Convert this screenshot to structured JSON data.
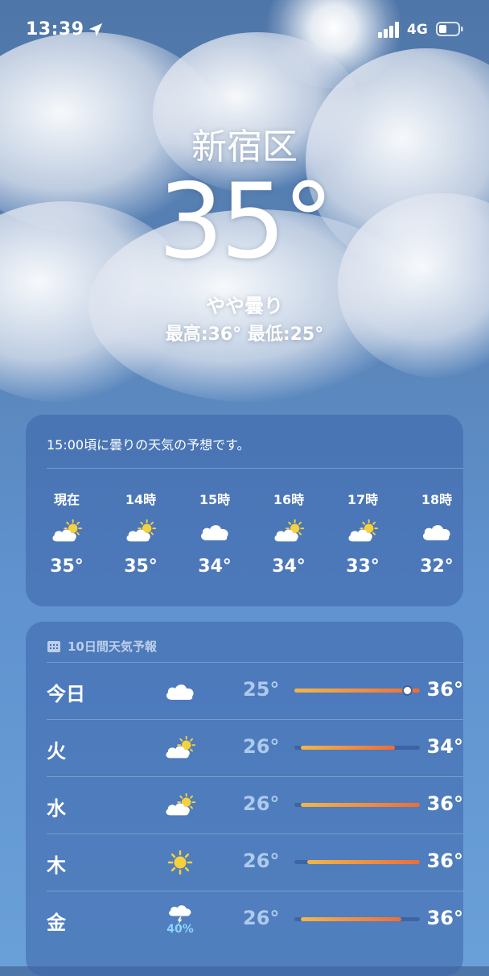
{
  "status_bar": {
    "time": "13:39",
    "network": "4G"
  },
  "location": "新宿区",
  "current": {
    "temp": "35°",
    "condition": "やや曇り",
    "hilo": "最高:36°  最低:25°"
  },
  "hourly": {
    "headline": "15:00頃に曇りの天気の予想です。",
    "items": [
      {
        "label": "現在",
        "icon": "partly-cloudy-icon",
        "temp": "35°"
      },
      {
        "label": "14時",
        "icon": "partly-cloudy-icon",
        "temp": "35°"
      },
      {
        "label": "15時",
        "icon": "cloud-icon",
        "temp": "34°"
      },
      {
        "label": "16時",
        "icon": "partly-cloudy-icon",
        "temp": "34°"
      },
      {
        "label": "17時",
        "icon": "partly-cloudy-icon",
        "temp": "33°"
      },
      {
        "label": "18時",
        "icon": "cloud-icon",
        "temp": "32°"
      }
    ]
  },
  "daily": {
    "header": "10日間天気予報",
    "rows": [
      {
        "day": "今日",
        "icon": "cloud-icon",
        "low": "25°",
        "high": "36°",
        "bar_start": 0.0,
        "bar_end": 1.0,
        "current_marker": 0.9
      },
      {
        "day": "火",
        "icon": "partly-cloudy-icon",
        "low": "26°",
        "high": "34°",
        "bar_start": 0.05,
        "bar_end": 0.8
      },
      {
        "day": "水",
        "icon": "partly-cloudy-icon",
        "low": "26°",
        "high": "36°",
        "bar_start": 0.05,
        "bar_end": 1.0
      },
      {
        "day": "木",
        "icon": "sun-icon",
        "low": "26°",
        "high": "36°",
        "bar_start": 0.1,
        "bar_end": 1.0
      },
      {
        "day": "金",
        "icon": "thunderstorm-icon",
        "precip": "40%",
        "low": "26°",
        "high": "36°",
        "bar_start": 0.05,
        "bar_end": 0.85
      }
    ]
  },
  "colors": {
    "bar_start": "#f0b64a",
    "bar_end": "#ec6d3a",
    "low_temp": "#bed7f5"
  }
}
